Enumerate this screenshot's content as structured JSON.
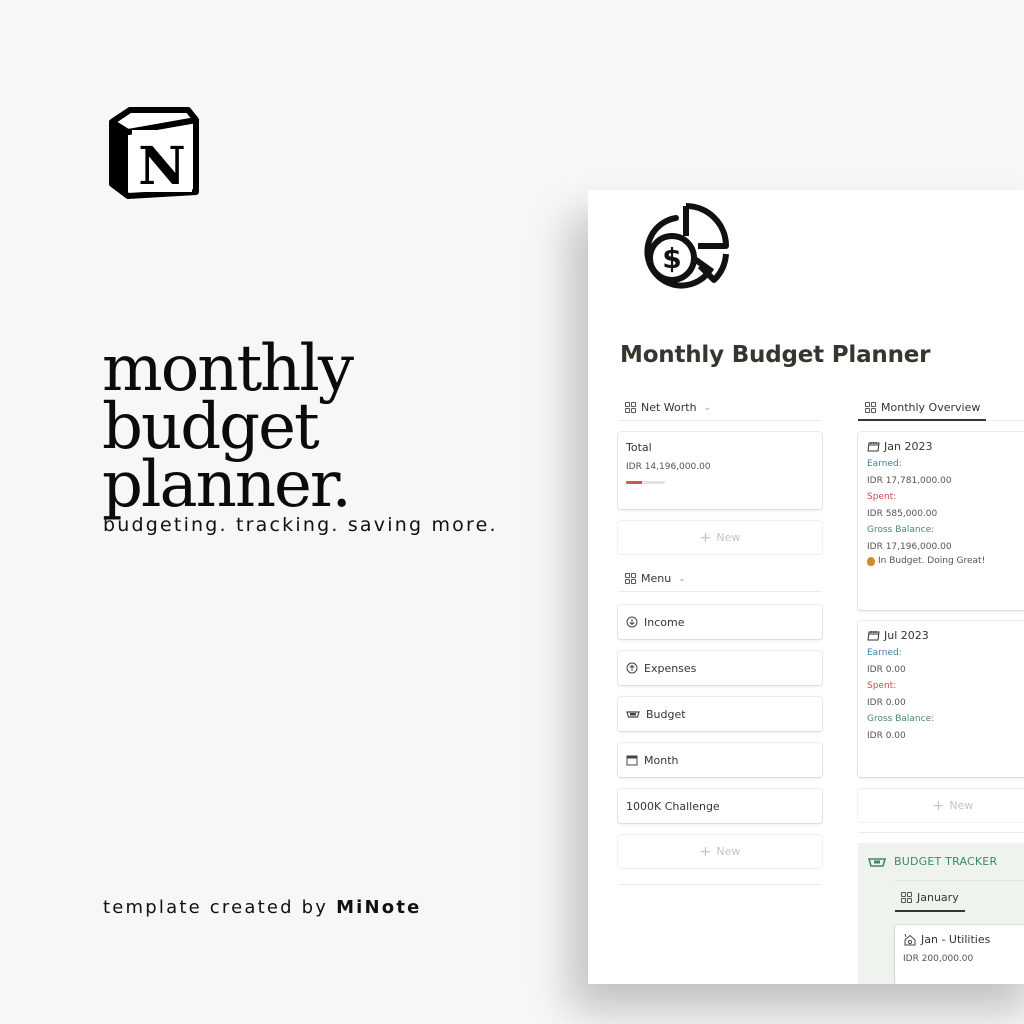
{
  "promo": {
    "headline_lines": [
      "monthly",
      "budget",
      "planner."
    ],
    "tagline": "budgeting. tracking. saving more.",
    "credit_prefix": "template created by ",
    "credit_name": "MiNote",
    "logo_letter": "N"
  },
  "page": {
    "title": "Monthly Budget Planner",
    "icon": "coin-pie-chart-icon"
  },
  "net_worth": {
    "view_label": "Net Worth",
    "cards": [
      {
        "title": "Total",
        "value": "IDR 14,196,000.00",
        "progress_percent": 40
      }
    ],
    "new_label": "New"
  },
  "menu": {
    "view_label": "Menu",
    "items": [
      {
        "label": "Income",
        "icon": "arrow-down-circle-icon"
      },
      {
        "label": "Expenses",
        "icon": "arrow-up-circle-icon"
      },
      {
        "label": "Budget",
        "icon": "money-tray-icon"
      },
      {
        "label": "Month",
        "icon": "calendar-icon"
      },
      {
        "label": "1000K Challenge",
        "icon": ""
      }
    ],
    "new_label": "New"
  },
  "monthly_overview": {
    "view_label": "Monthly Overview",
    "months": [
      {
        "title": "Jan 2023",
        "earned_label": "Earned:",
        "earned": "IDR 17,781,000.00",
        "spent_label": "Spent:",
        "spent": "IDR 585,000.00",
        "gross_label": "Gross Balance:",
        "gross": "IDR 17,196,000.00",
        "status": "In Budget. Doing Great!"
      },
      {
        "title": "Jul 2023",
        "earned_label": "Earned:",
        "earned": "IDR 0.00",
        "spent_label": "Spent:",
        "spent": "IDR 0.00",
        "gross_label": "Gross Balance:",
        "gross": "IDR 0.00"
      }
    ],
    "new_label": "New"
  },
  "budget_tracker": {
    "heading": "BUDGET TRACKER",
    "tab_label": "January",
    "cards": [
      {
        "title": "Jan - Utilities",
        "value": "IDR 200,000.00"
      }
    ]
  },
  "colors": {
    "progress_fill": "#d2574c",
    "earned": "#3e7fa8",
    "spent": "#c0504a",
    "gross": "#4a8a6a",
    "tracker_bg": "#eef3ee",
    "tracker_text": "#3d8a60"
  }
}
